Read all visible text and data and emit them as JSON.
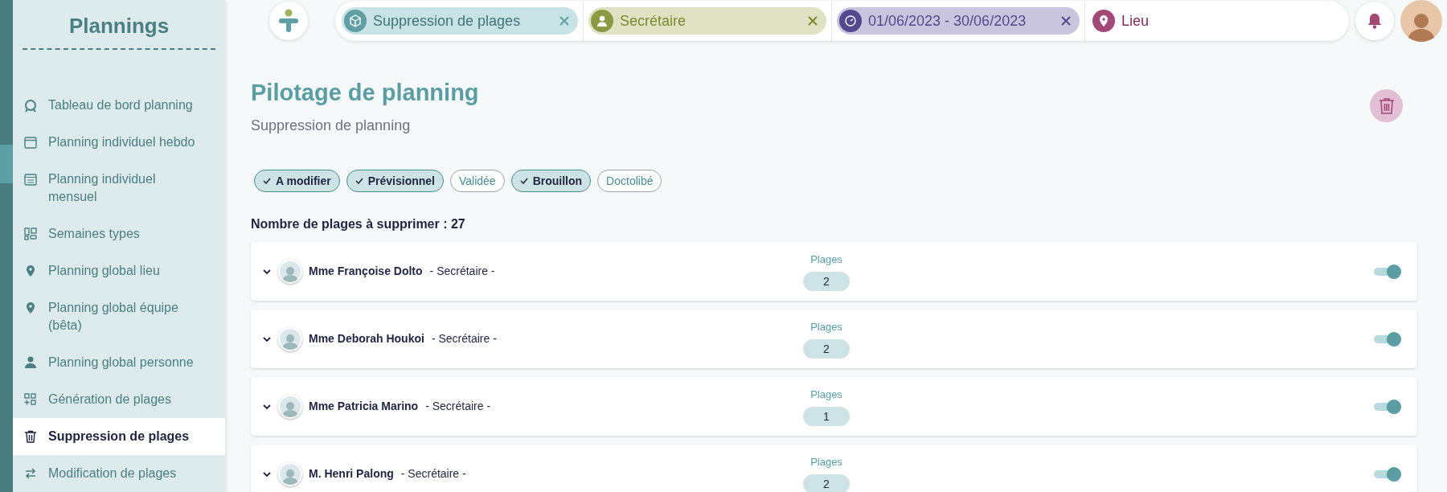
{
  "sidebar": {
    "title": "Plannings",
    "items": [
      {
        "label": "Tableau de bord planning",
        "kind": "dashboard",
        "selected": false
      },
      {
        "label": "Planning individuel hebdo",
        "kind": "calendar-day",
        "selected": false
      },
      {
        "label": "Planning individuel mensuel",
        "kind": "calendar-month",
        "selected": false
      },
      {
        "label": "Semaines types",
        "kind": "layout",
        "selected": false
      },
      {
        "label": "Planning global lieu",
        "kind": "pin",
        "selected": false
      },
      {
        "label": "Planning global équipe (bêta)",
        "kind": "pin",
        "selected": false
      },
      {
        "label": "Planning global personne",
        "kind": "person",
        "selected": false
      },
      {
        "label": "Génération de plages",
        "kind": "grid-plus",
        "selected": false
      },
      {
        "label": "Suppression de plages",
        "kind": "trash",
        "selected": true
      },
      {
        "label": "Modification de plages",
        "kind": "swap",
        "selected": false
      }
    ]
  },
  "filters": [
    {
      "label": "Suppression de plages",
      "kind": "activity",
      "removable": true
    },
    {
      "label": "Secrétaire",
      "kind": "role",
      "removable": true
    },
    {
      "label": "01/06/2023 - 30/06/2023",
      "kind": "period",
      "removable": true
    },
    {
      "label": "Lieu",
      "kind": "place",
      "removable": false
    }
  ],
  "page": {
    "title": "Pilotage de planning",
    "subtitle": "Suppression de planning"
  },
  "status_chips": [
    {
      "label": "A modifier",
      "selected": true
    },
    {
      "label": "Prévisionnel",
      "selected": true
    },
    {
      "label": "Validée",
      "selected": false
    },
    {
      "label": "Brouillon",
      "selected": true
    },
    {
      "label": "Doctolibé",
      "selected": false
    }
  ],
  "count_label": "Nombre de plages à supprimer : 27",
  "rows": [
    {
      "name": "Mme Françoise Dolto",
      "role": "- Secrétaire -",
      "plages_label": "Plages",
      "count": "2",
      "on": true
    },
    {
      "name": "Mme Deborah Houkoi",
      "role": "- Secrétaire -",
      "plages_label": "Plages",
      "count": "2",
      "on": true
    },
    {
      "name": "Mme Patricia Marino",
      "role": "- Secrétaire -",
      "plages_label": "Plages",
      "count": "1",
      "on": true
    },
    {
      "name": "M. Henri Palong",
      "role": "- Secrétaire -",
      "plages_label": "Plages",
      "count": "2",
      "on": true
    }
  ]
}
